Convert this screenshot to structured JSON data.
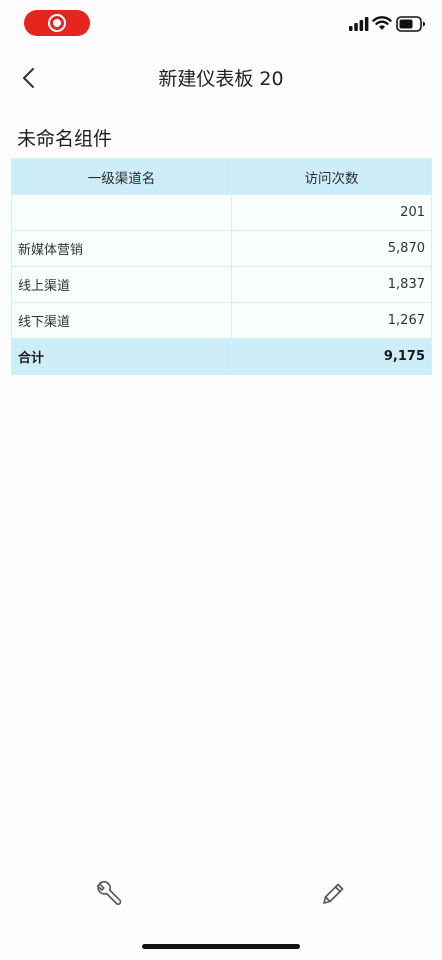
{
  "status_bar": {
    "record_icon": "screen-record-icon",
    "signal_icon": "cellular-signal-icon",
    "wifi_icon": "wifi-icon",
    "battery_icon": "battery-icon",
    "record_color": "#e5261f"
  },
  "nav": {
    "back_icon": "chevron-left-icon",
    "title": "新建仪表板 20"
  },
  "widget": {
    "title": "未命名组件"
  },
  "table": {
    "headers": [
      "一级渠道名",
      "访问次数"
    ],
    "rows": [
      {
        "channel": "",
        "visits": "201"
      },
      {
        "channel": "新媒体营销",
        "visits": "5,870"
      },
      {
        "channel": "线上渠道",
        "visits": "1,837"
      },
      {
        "channel": "线下渠道",
        "visits": "1,267"
      }
    ],
    "total": {
      "label": "合计",
      "visits": "9,175"
    },
    "header_bg": "#cdedf8"
  },
  "toolbar": {
    "wrench_icon": "wrench-icon",
    "pencil_icon": "pencil-icon"
  }
}
